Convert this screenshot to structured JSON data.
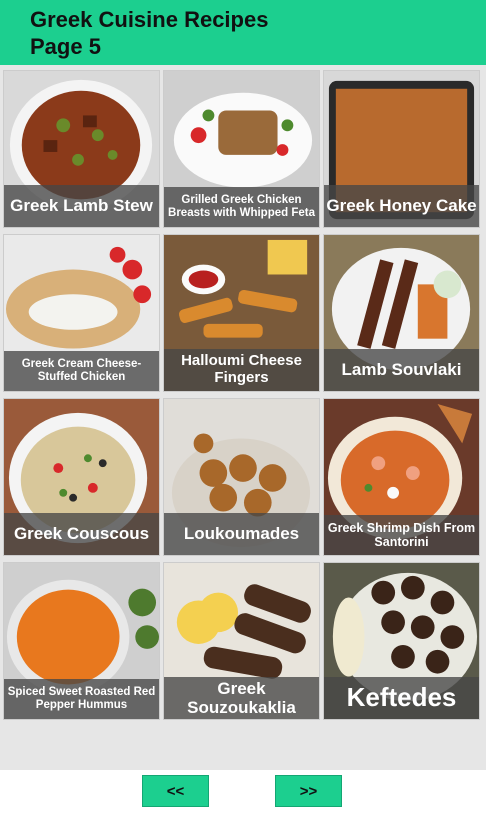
{
  "header": {
    "title_line1": "Greek Cuisine Recipes",
    "title_line2": "Page 5"
  },
  "recipes": [
    {
      "name": "Greek Lamb Stew"
    },
    {
      "name": "Grilled Greek Chicken Breasts with Whipped Feta"
    },
    {
      "name": "Greek Honey Cake"
    },
    {
      "name": "Greek Cream Cheese-Stuffed Chicken"
    },
    {
      "name": "Halloumi Cheese Fingers"
    },
    {
      "name": "Lamb Souvlaki"
    },
    {
      "name": "Greek Couscous"
    },
    {
      "name": "Loukoumades"
    },
    {
      "name": "Greek Shrimp Dish From Santorini"
    },
    {
      "name": "Spiced Sweet Roasted Red Pepper Hummus"
    },
    {
      "name": "Greek Souzoukaklia"
    },
    {
      "name": "Keftedes"
    }
  ],
  "nav": {
    "prev_label": "<<",
    "next_label": ">>"
  },
  "colors": {
    "accent": "#1ccf8f",
    "caption_bg": "#464646"
  }
}
